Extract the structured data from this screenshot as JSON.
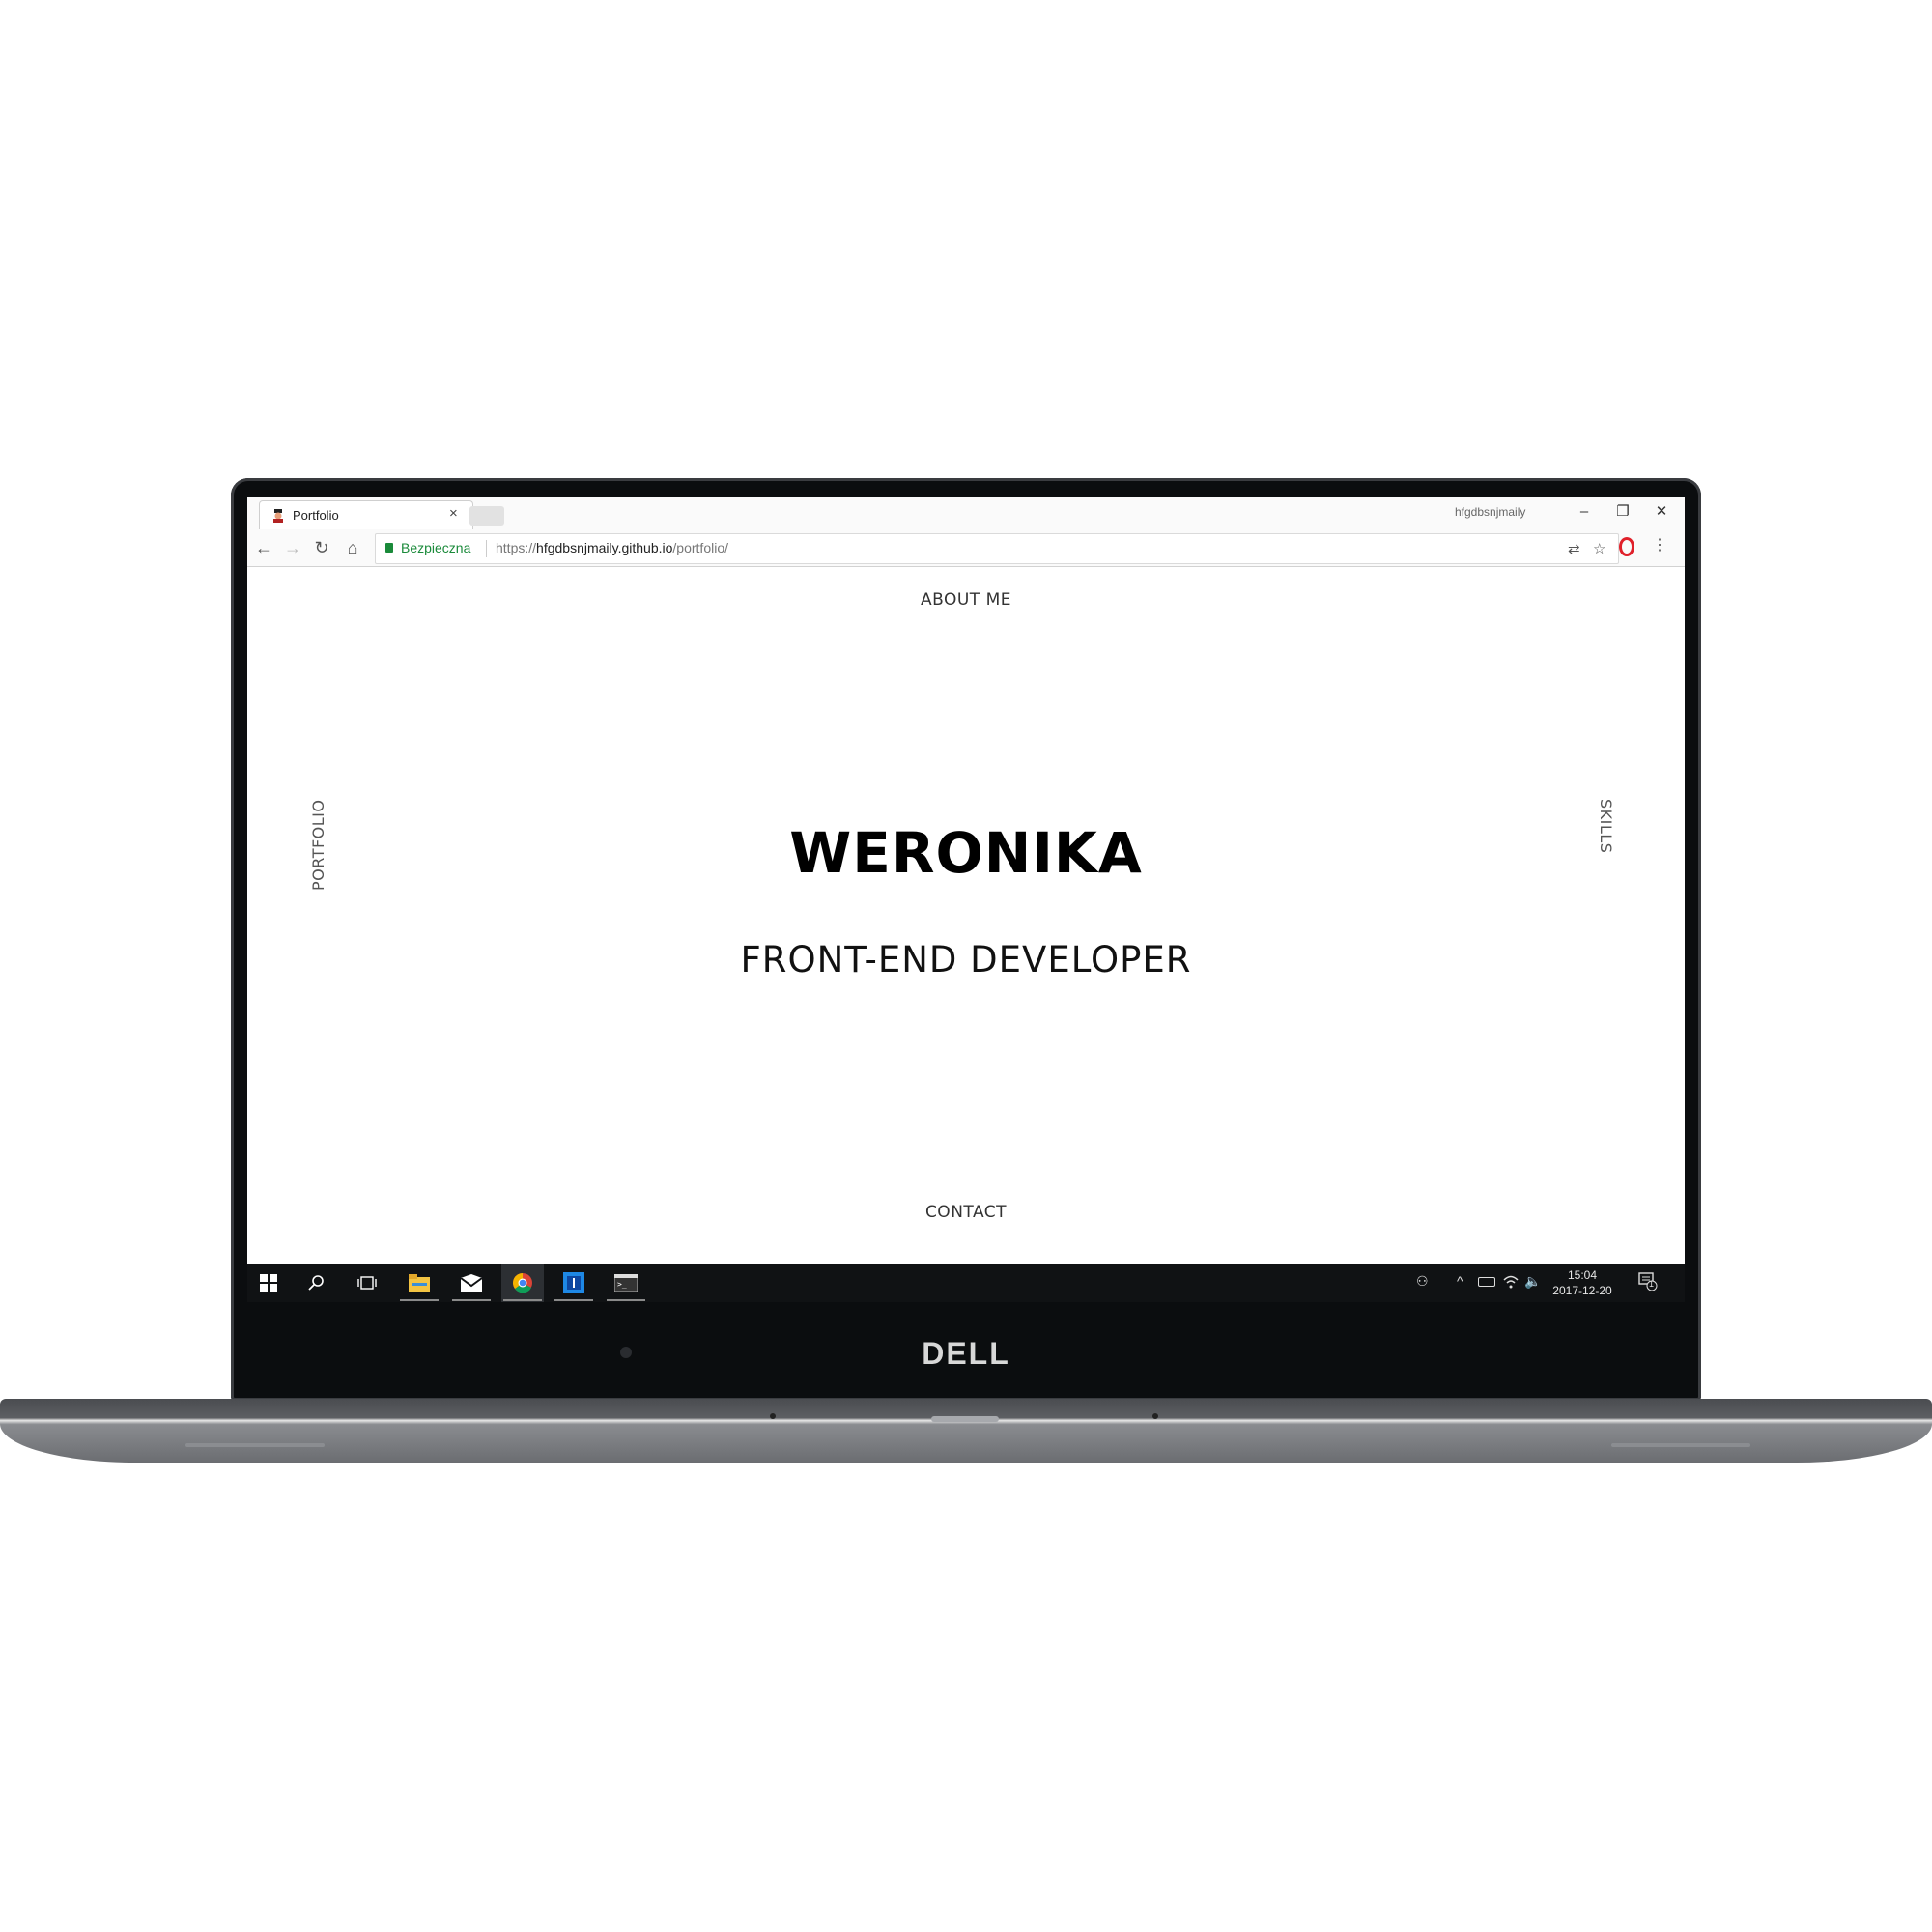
{
  "device": {
    "brand": "DELL"
  },
  "browser": {
    "tab_title": "Portfolio",
    "tab_close": "×",
    "profile_name": "hfgdbsnjmaily",
    "window_controls": {
      "minimize": "–",
      "restore": "❐",
      "close": "✕"
    },
    "nav": {
      "back": "←",
      "forward": "→",
      "reload": "↻",
      "home": "⌂"
    },
    "security_label": "Bezpieczna",
    "url_scheme": "https://",
    "url_host": "hfgdbsnjmaily.github.io",
    "url_path": "/portfolio/",
    "icons": [
      "translate-icon",
      "star-icon",
      "opera-icon",
      "menu-icon"
    ],
    "star_glyph": "☆",
    "translate_glyph": "⇄",
    "menu_glyph": "⋮"
  },
  "page": {
    "nav_top": "ABOUT ME",
    "nav_bottom": "CONTACT",
    "nav_left": "PORTFOLIO",
    "nav_right": "SKILLS",
    "hero_name": "WERONIKA",
    "hero_role": "FRONT-END DEVELOPER"
  },
  "taskbar": {
    "apps": [
      "windows-start-icon",
      "search-icon",
      "task-view-icon",
      "file-explorer-icon",
      "mail-icon",
      "chrome-icon",
      "vscode-icon",
      "terminal-icon"
    ],
    "clock_time": "15:04",
    "clock_date": "2017-12-20",
    "notification_count": "1",
    "tray": {
      "people": "⚇",
      "chevron": "^",
      "volume": "🔈"
    }
  },
  "colors": {
    "secure_green": "#1a8a3a",
    "opera_red": "#e0202a",
    "taskbar_bg": "#101214",
    "bezel": "#0b0d0f"
  }
}
